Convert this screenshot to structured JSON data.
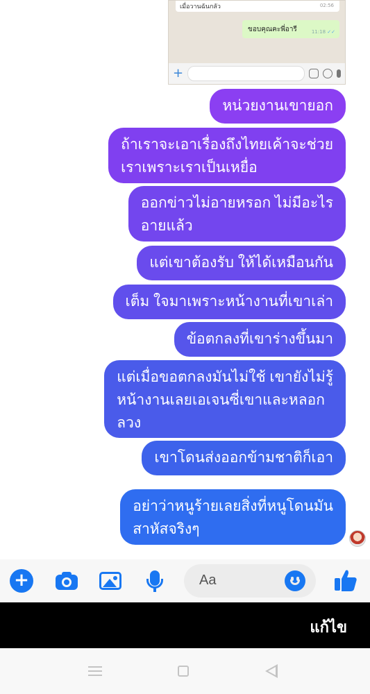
{
  "embedded_chat": {
    "top_message": "เมื่อวานฉันกลัว",
    "top_time": "02:56",
    "reply_text": "ขอบคุณคะพี่อารี",
    "reply_time": "11:18",
    "reply_checks": "✓✓",
    "plus": "+"
  },
  "messages": [
    {
      "lines": [
        "หน่วยงานเขายอก"
      ],
      "color": "#8b3ff2"
    },
    {
      "lines": [
        "ถ้าเราจะเอาเรื่องถึงไทยเค้าจะช่วย",
        "เราเพราะเราเป็นเหยื่อ"
      ],
      "color": "#8040f0"
    },
    {
      "lines": [
        "ออกข่าวไม่อายหรอก ไม่มีอะไร",
        "อายแล้ว"
      ],
      "color": "#7346ee"
    },
    {
      "lines": [
        "แต่เขาต้องรับ ให้ได้เหมือนกัน"
      ],
      "color": "#6a4bed"
    },
    {
      "lines": [
        "เต็ม ใจมาเพราะหน้างานที่เขาเล่า"
      ],
      "color": "#604fec"
    },
    {
      "lines": [
        "ข้อตกลงที่เขาร่างขึ้นมา"
      ],
      "color": "#5655eb"
    },
    {
      "lines": [
        "แต่เมื่อขอตกลงมันไม่ใช้ เขายังไม่รู้",
        "หน้างานเลยเอเจนซี่เขาและหลอก",
        "ลวง"
      ],
      "color": "#4a5bea"
    },
    {
      "lines": [
        "เขาโดนส่งออกข้ามชาติก็เอา"
      ],
      "color": "#3d62eb"
    },
    {
      "lines": [
        "อย่าว่าหนูร้ายเลยสิ่งที่หนูโดนมัน",
        "สาหัสจริงๆ"
      ],
      "color": "#2f6df0"
    }
  ],
  "composer": {
    "plus": "+",
    "placeholder": "Aa"
  },
  "edit_bar": {
    "label": "แก้ไข"
  }
}
